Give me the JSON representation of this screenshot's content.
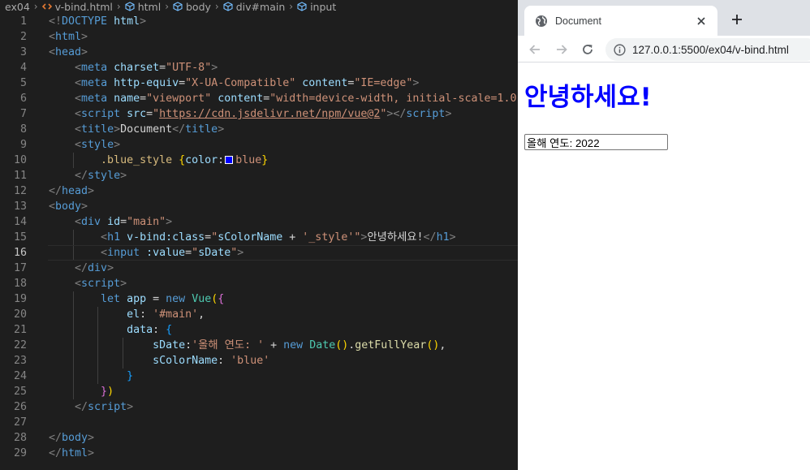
{
  "editor": {
    "breadcrumb": [
      "ex04",
      "v-bind.html",
      "html",
      "body",
      "div#main",
      "input"
    ],
    "active_line": 16,
    "lines": [
      [
        [
          "t-br",
          "<!"
        ],
        [
          "t-tag",
          "DOCTYPE"
        ],
        [
          "t-text",
          " "
        ],
        [
          "t-attr",
          "html"
        ],
        [
          "t-br",
          ">"
        ]
      ],
      [
        [
          "t-br",
          "<"
        ],
        [
          "t-tag",
          "html"
        ],
        [
          "t-br",
          ">"
        ]
      ],
      [
        [
          "t-br",
          "<"
        ],
        [
          "t-tag",
          "head"
        ],
        [
          "t-br",
          ">"
        ]
      ],
      [
        [
          "t-text",
          "    "
        ],
        [
          "t-br",
          "<"
        ],
        [
          "t-tag",
          "meta"
        ],
        [
          "t-text",
          " "
        ],
        [
          "t-attr",
          "charset"
        ],
        [
          "t-text",
          "="
        ],
        [
          "t-str",
          "\"UTF-8\""
        ],
        [
          "t-br",
          ">"
        ]
      ],
      [
        [
          "t-text",
          "    "
        ],
        [
          "t-br",
          "<"
        ],
        [
          "t-tag",
          "meta"
        ],
        [
          "t-text",
          " "
        ],
        [
          "t-attr",
          "http-equiv"
        ],
        [
          "t-text",
          "="
        ],
        [
          "t-str",
          "\"X-UA-Compatible\""
        ],
        [
          "t-text",
          " "
        ],
        [
          "t-attr",
          "content"
        ],
        [
          "t-text",
          "="
        ],
        [
          "t-str",
          "\"IE=edge\""
        ],
        [
          "t-br",
          ">"
        ]
      ],
      [
        [
          "t-text",
          "    "
        ],
        [
          "t-br",
          "<"
        ],
        [
          "t-tag",
          "meta"
        ],
        [
          "t-text",
          " "
        ],
        [
          "t-attr",
          "name"
        ],
        [
          "t-text",
          "="
        ],
        [
          "t-str",
          "\"viewport\""
        ],
        [
          "t-text",
          " "
        ],
        [
          "t-attr",
          "content"
        ],
        [
          "t-text",
          "="
        ],
        [
          "t-str",
          "\"width=device-width, initial-scale=1.0\""
        ],
        [
          "t-br",
          ">"
        ]
      ],
      [
        [
          "t-text",
          "    "
        ],
        [
          "t-br",
          "<"
        ],
        [
          "t-tag",
          "script"
        ],
        [
          "t-text",
          " "
        ],
        [
          "t-attr",
          "src"
        ],
        [
          "t-text",
          "="
        ],
        [
          "t-str",
          "\""
        ],
        [
          "t-link",
          "https://cdn.jsdelivr.net/npm/vue@2"
        ],
        [
          "t-str",
          "\""
        ],
        [
          "t-br",
          "></"
        ],
        [
          "t-tag",
          "script"
        ],
        [
          "t-br",
          ">"
        ]
      ],
      [
        [
          "t-text",
          "    "
        ],
        [
          "t-br",
          "<"
        ],
        [
          "t-tag",
          "title"
        ],
        [
          "t-br",
          ">"
        ],
        [
          "t-text",
          "Document"
        ],
        [
          "t-br",
          "</"
        ],
        [
          "t-tag",
          "title"
        ],
        [
          "t-br",
          ">"
        ]
      ],
      [
        [
          "t-text",
          "    "
        ],
        [
          "t-br",
          "<"
        ],
        [
          "t-tag",
          "style"
        ],
        [
          "t-br",
          ">"
        ]
      ],
      [
        [
          "t-text",
          "        "
        ],
        [
          "t-sel",
          ".blue_style"
        ],
        [
          "t-text",
          " "
        ],
        [
          "t-b1",
          "{"
        ],
        [
          "t-var",
          "color"
        ],
        [
          "t-text",
          ":"
        ],
        [
          "swatch",
          "#0000ff"
        ],
        [
          "t-str",
          "blue"
        ],
        [
          "t-b1",
          "}"
        ]
      ],
      [
        [
          "t-text",
          "    "
        ],
        [
          "t-br",
          "</"
        ],
        [
          "t-tag",
          "style"
        ],
        [
          "t-br",
          ">"
        ]
      ],
      [
        [
          "t-br",
          "</"
        ],
        [
          "t-tag",
          "head"
        ],
        [
          "t-br",
          ">"
        ]
      ],
      [
        [
          "t-br",
          "<"
        ],
        [
          "t-tag",
          "body"
        ],
        [
          "t-br",
          ">"
        ]
      ],
      [
        [
          "t-text",
          "    "
        ],
        [
          "t-br",
          "<"
        ],
        [
          "t-tag",
          "div"
        ],
        [
          "t-text",
          " "
        ],
        [
          "t-attr",
          "id"
        ],
        [
          "t-text",
          "="
        ],
        [
          "t-str",
          "\"main\""
        ],
        [
          "t-br",
          ">"
        ]
      ],
      [
        [
          "t-text",
          "        "
        ],
        [
          "t-br",
          "<"
        ],
        [
          "t-tag",
          "h1"
        ],
        [
          "t-text",
          " "
        ],
        [
          "t-attr",
          "v-bind:class"
        ],
        [
          "t-text",
          "="
        ],
        [
          "t-str",
          "\""
        ],
        [
          "t-var",
          "sColorName"
        ],
        [
          "t-text",
          " + "
        ],
        [
          "t-str",
          "'_style'"
        ],
        [
          "t-str",
          "\""
        ],
        [
          "t-br",
          ">"
        ],
        [
          "t-text",
          "안녕하세요!"
        ],
        [
          "t-br",
          "</"
        ],
        [
          "t-tag",
          "h1"
        ],
        [
          "t-br",
          ">"
        ]
      ],
      [
        [
          "t-text",
          "        "
        ],
        [
          "t-br",
          "<"
        ],
        [
          "t-tag",
          "input"
        ],
        [
          "t-text",
          " "
        ],
        [
          "t-attr",
          ":value"
        ],
        [
          "t-text",
          "="
        ],
        [
          "t-str",
          "\""
        ],
        [
          "t-var",
          "sDate"
        ],
        [
          "t-str",
          "\""
        ],
        [
          "t-br",
          ">"
        ]
      ],
      [
        [
          "t-text",
          "    "
        ],
        [
          "t-br",
          "</"
        ],
        [
          "t-tag",
          "div"
        ],
        [
          "t-br",
          ">"
        ]
      ],
      [
        [
          "t-text",
          "    "
        ],
        [
          "t-br",
          "<"
        ],
        [
          "t-tag",
          "script"
        ],
        [
          "t-br",
          ">"
        ]
      ],
      [
        [
          "t-text",
          "        "
        ],
        [
          "t-kw",
          "let"
        ],
        [
          "t-text",
          " "
        ],
        [
          "t-var",
          "app"
        ],
        [
          "t-text",
          " = "
        ],
        [
          "t-kw",
          "new"
        ],
        [
          "t-text",
          " "
        ],
        [
          "t-cls",
          "Vue"
        ],
        [
          "t-b1",
          "("
        ],
        [
          "t-b2",
          "{"
        ]
      ],
      [
        [
          "t-text",
          "            "
        ],
        [
          "t-var",
          "el"
        ],
        [
          "t-text",
          ": "
        ],
        [
          "t-str",
          "'#main'"
        ],
        [
          "t-text",
          ","
        ]
      ],
      [
        [
          "t-text",
          "            "
        ],
        [
          "t-var",
          "data"
        ],
        [
          "t-text",
          ": "
        ],
        [
          "t-b3",
          "{"
        ]
      ],
      [
        [
          "t-text",
          "                "
        ],
        [
          "t-var",
          "sDate"
        ],
        [
          "t-text",
          ":"
        ],
        [
          "t-str",
          "'올해 연도: '"
        ],
        [
          "t-text",
          " + "
        ],
        [
          "t-kw",
          "new"
        ],
        [
          "t-text",
          " "
        ],
        [
          "t-cls",
          "Date"
        ],
        [
          "t-b1",
          "()"
        ],
        [
          "t-text",
          "."
        ],
        [
          "t-fn",
          "getFullYear"
        ],
        [
          "t-b1",
          "()"
        ],
        [
          "t-text",
          ","
        ]
      ],
      [
        [
          "t-text",
          "                "
        ],
        [
          "t-var",
          "sColorName"
        ],
        [
          "t-text",
          ": "
        ],
        [
          "t-str",
          "'blue'"
        ]
      ],
      [
        [
          "t-text",
          "            "
        ],
        [
          "t-b3",
          "}"
        ]
      ],
      [
        [
          "t-text",
          "        "
        ],
        [
          "t-b2",
          "}"
        ],
        [
          "t-b1",
          ")"
        ]
      ],
      [
        [
          "t-text",
          "    "
        ],
        [
          "t-br",
          "</"
        ],
        [
          "t-tag",
          "script"
        ],
        [
          "t-br",
          ">"
        ]
      ],
      [],
      [
        [
          "t-br",
          "</"
        ],
        [
          "t-tag",
          "body"
        ],
        [
          "t-br",
          ">"
        ]
      ],
      [
        [
          "t-br",
          "</"
        ],
        [
          "t-tag",
          "html"
        ],
        [
          "t-br",
          ">"
        ]
      ]
    ]
  },
  "browser": {
    "tab_title": "Document",
    "url": "127.0.0.1:5500/ex04/v-bind.html",
    "icons": {
      "favicon": "globe-icon",
      "close": "close-icon",
      "new_tab": "plus-icon",
      "back": "arrow-left-icon",
      "forward": "arrow-right-icon",
      "reload": "reload-icon",
      "site_info": "info-icon"
    },
    "page": {
      "heading": "안녕하세요!",
      "heading_color": "#0000ff",
      "input_value": "올해 연도: 2022"
    }
  }
}
